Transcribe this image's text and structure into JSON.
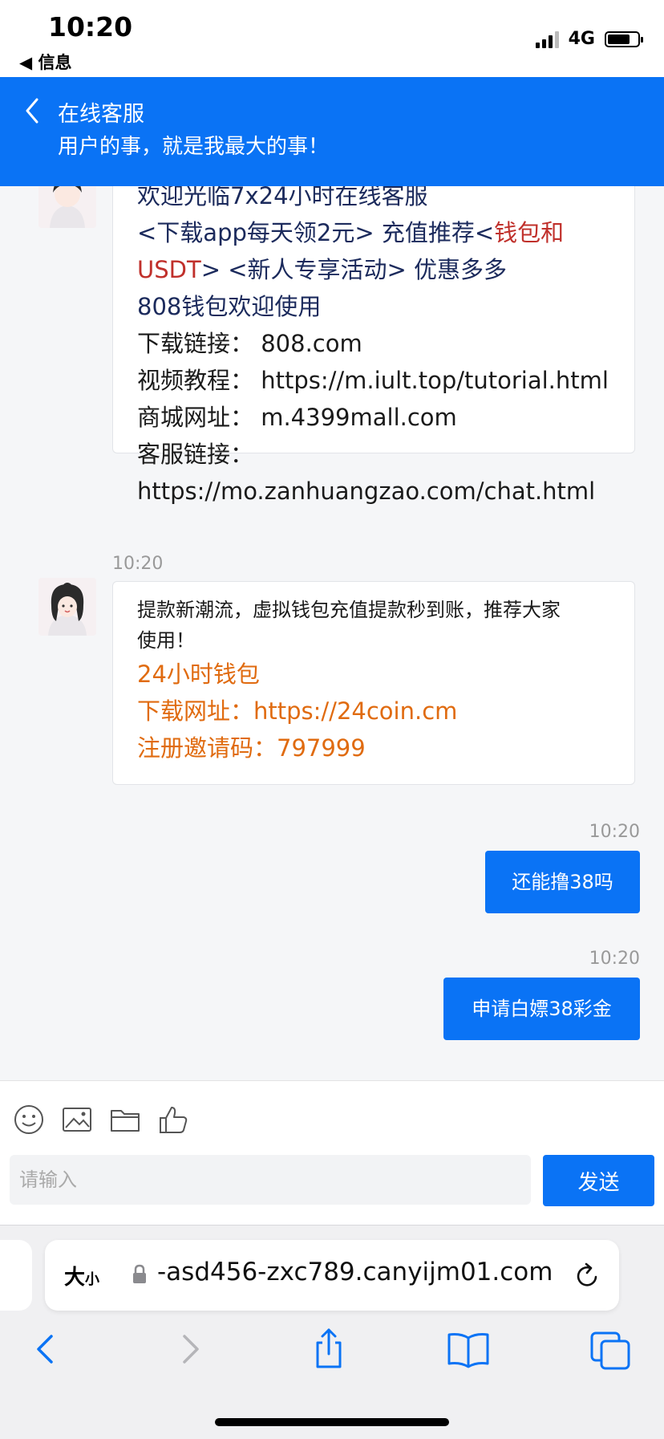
{
  "status_bar": {
    "time": "10:20",
    "back_label": "◀ 信息",
    "network": "4G",
    "battery_level": 0.75
  },
  "header": {
    "title": "在线客服",
    "subtitle": "用户的事，就是我最大的事！"
  },
  "messages": {
    "first": {
      "lines": [
        [
          {
            "text": "欢迎光临7x24小时在线客服",
            "color": "navy"
          }
        ],
        [
          {
            "text": "<下载app每天领2元> 充值推荐<",
            "color": "navy"
          },
          {
            "text": "钱包和",
            "color": "red"
          }
        ],
        [
          {
            "text": "USDT",
            "color": "red"
          },
          {
            "text": "> <新人专享活动> 优惠多多",
            "color": "navy"
          }
        ],
        [
          {
            "text": "808钱包欢迎使用",
            "color": "navy"
          }
        ],
        [
          {
            "text": "下载链接：  808.com",
            "color": "black"
          }
        ],
        [
          {
            "text": "视频教程：  https://m.iult.top/tutorial.html",
            "color": "black"
          }
        ],
        [
          {
            "text": "商城网址：  m.4399mall.com",
            "color": "black"
          }
        ],
        [
          {
            "text": "客服链接：",
            "color": "black"
          }
        ],
        [
          {
            "text": "https://mo.zanhuangzao.com/chat.html",
            "color": "black"
          }
        ]
      ]
    },
    "second": {
      "time": "10:20",
      "intro": "提款新潮流，虚拟钱包充值提款秒到账，推荐大家",
      "intro2": "使用！",
      "wallet": "24小时钱包",
      "download": "下载网址：https://24coin.cm",
      "invite": "注册邀请码：797999"
    },
    "outgoing": [
      {
        "time": "10:20",
        "text": "还能撸38吗"
      },
      {
        "time": "10:20",
        "text": "申请白嫖38彩金"
      }
    ]
  },
  "composer": {
    "placeholder": "请输入",
    "send_label": "发送",
    "tools": [
      "emoji-icon",
      "image-icon",
      "folder-icon",
      "thumbs-up-icon"
    ]
  },
  "browser": {
    "text_size_label": "大",
    "text_size_small": "小",
    "url": "-asd456-zxc789.canyijm01.com"
  },
  "colors": {
    "accent": "#0a73f5",
    "navy_text": "#1b2a5c",
    "red_text": "#c0302b",
    "orange_text": "#e06b10"
  }
}
